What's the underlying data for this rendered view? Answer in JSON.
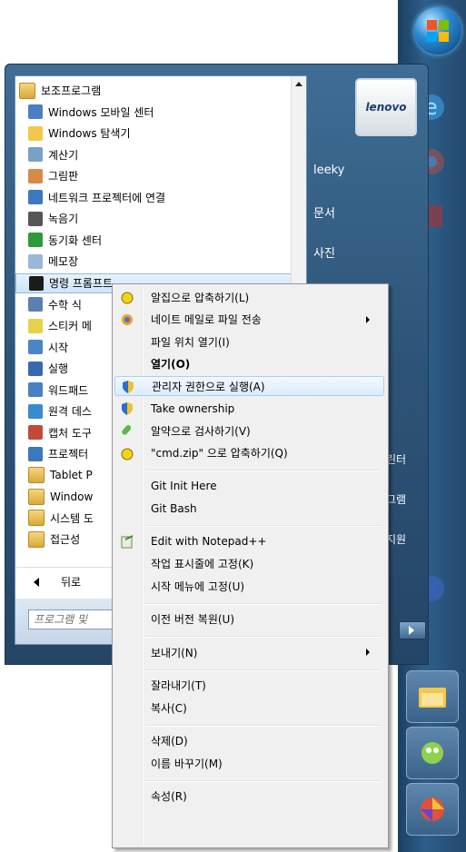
{
  "start_menu": {
    "programs": [
      {
        "label": "보조프로그램",
        "icon": "folder-icon",
        "indent": false
      },
      {
        "label": "Windows 모바일 센터",
        "icon": "mobility-center-icon",
        "indent": true
      },
      {
        "label": "Windows 탐색기",
        "icon": "explorer-icon",
        "indent": true
      },
      {
        "label": "계산기",
        "icon": "calculator-icon",
        "indent": true
      },
      {
        "label": "그림판",
        "icon": "paint-icon",
        "indent": true
      },
      {
        "label": "네트워크 프로젝터에 연결",
        "icon": "projector-icon",
        "indent": true
      },
      {
        "label": "녹음기",
        "icon": "microphone-icon",
        "indent": true
      },
      {
        "label": "동기화 센터",
        "icon": "sync-icon",
        "indent": true
      },
      {
        "label": "메모장",
        "icon": "notepad-icon",
        "indent": true
      },
      {
        "label": "명령 프롬프트",
        "icon": "cmd-icon",
        "indent": true
      },
      {
        "label": "수학 식",
        "icon": "math-icon",
        "indent": true
      },
      {
        "label": "스티커 메",
        "icon": "sticky-notes-icon",
        "indent": true
      },
      {
        "label": "시작",
        "icon": "start-icon",
        "indent": true
      },
      {
        "label": "실행",
        "icon": "run-icon",
        "indent": true
      },
      {
        "label": "워드패드",
        "icon": "wordpad-icon",
        "indent": true
      },
      {
        "label": "원격 데스",
        "icon": "remote-desktop-icon",
        "indent": true
      },
      {
        "label": "캡처 도구",
        "icon": "snipping-icon",
        "indent": true
      },
      {
        "label": "프로젝터",
        "icon": "projector-icon",
        "indent": true
      },
      {
        "label": "Tablet P",
        "icon": "folder-icon",
        "indent": true
      },
      {
        "label": "Window",
        "icon": "folder-icon",
        "indent": true
      },
      {
        "label": "시스템 도",
        "icon": "folder-icon",
        "indent": true
      },
      {
        "label": "접근성",
        "icon": "folder-icon",
        "indent": true
      }
    ],
    "back_label": "뒤로",
    "search_placeholder": "프로그램 및",
    "user_logo": "lenovo",
    "right_links": [
      "leeky",
      "문서",
      "사진"
    ],
    "right_partial": [
      "린터",
      "그램",
      "지원"
    ]
  },
  "context_menu": {
    "items": [
      {
        "label": "알집으로 압축하기(L)",
        "icon": "alzip-icon"
      },
      {
        "label": "네이트 메일로 파일 전송",
        "icon": "nate-icon",
        "submenu": true
      },
      {
        "label": "파일 위치 열기(I)"
      },
      {
        "label": "열기(O)",
        "bold": true
      },
      {
        "label": "관리자 권한으로 실행(A)",
        "icon": "shield-icon",
        "highlight": true
      },
      {
        "label": "Take ownership",
        "icon": "shield-icon"
      },
      {
        "label": "알약으로 검사하기(V)",
        "icon": "alyac-icon"
      },
      {
        "label": "\"cmd.zip\" 으로 압축하기(Q)",
        "icon": "alzip-icon"
      },
      {
        "separator": true
      },
      {
        "label": "Git Init Here"
      },
      {
        "label": "Git Bash"
      },
      {
        "separator": true
      },
      {
        "label": "Edit with Notepad++",
        "icon": "notepadpp-icon"
      },
      {
        "label": "작업 표시줄에 고정(K)"
      },
      {
        "label": "시작 메뉴에 고정(U)"
      },
      {
        "separator": true
      },
      {
        "label": "이전 버전 복원(U)"
      },
      {
        "separator": true
      },
      {
        "label": "보내기(N)",
        "submenu": true
      },
      {
        "separator": true
      },
      {
        "label": "잘라내기(T)"
      },
      {
        "label": "복사(C)"
      },
      {
        "separator": true
      },
      {
        "label": "삭제(D)"
      },
      {
        "label": "이름 바꾸기(M)"
      },
      {
        "separator": true
      },
      {
        "label": "속성(R)"
      }
    ]
  }
}
